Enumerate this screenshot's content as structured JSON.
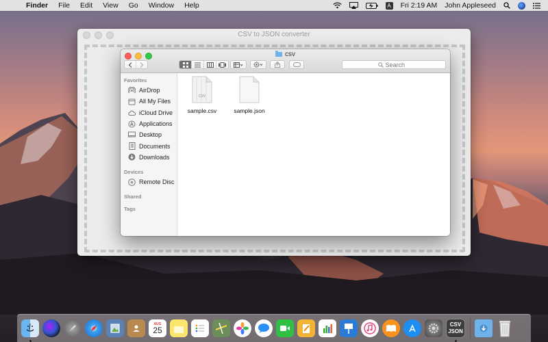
{
  "menubar": {
    "app_name": "Finder",
    "items": [
      "File",
      "Edit",
      "View",
      "Go",
      "Window",
      "Help"
    ],
    "input_source": "A",
    "clock": "Fri 2:19 AM",
    "user": "John Appleseed"
  },
  "converter": {
    "title": "CSV to JSON converter"
  },
  "finder": {
    "title": "csv",
    "search_placeholder": "Search",
    "sidebar": {
      "favorites_header": "Favorites",
      "favorites": [
        "AirDrop",
        "All My Files",
        "iCloud Drive",
        "Applications",
        "Desktop",
        "Documents",
        "Downloads"
      ],
      "devices_header": "Devices",
      "devices": [
        "Remote Disc"
      ],
      "shared_header": "Shared",
      "tags_header": "Tags"
    },
    "files": [
      {
        "name": "sample.csv",
        "badge": "CSV",
        "icon": "csv-document-icon"
      },
      {
        "name": "sample.json",
        "badge": "",
        "icon": "document-icon"
      }
    ]
  },
  "dock": {
    "calendar_month": "AUG",
    "calendar_day": "25",
    "converter_icon_top": "CSV",
    "converter_icon_bottom": "JSON"
  },
  "colors": {
    "close": "#fc605c",
    "minimize": "#fdbc40",
    "zoom": "#34c84a",
    "folder_blue": "#6fb2ea"
  }
}
